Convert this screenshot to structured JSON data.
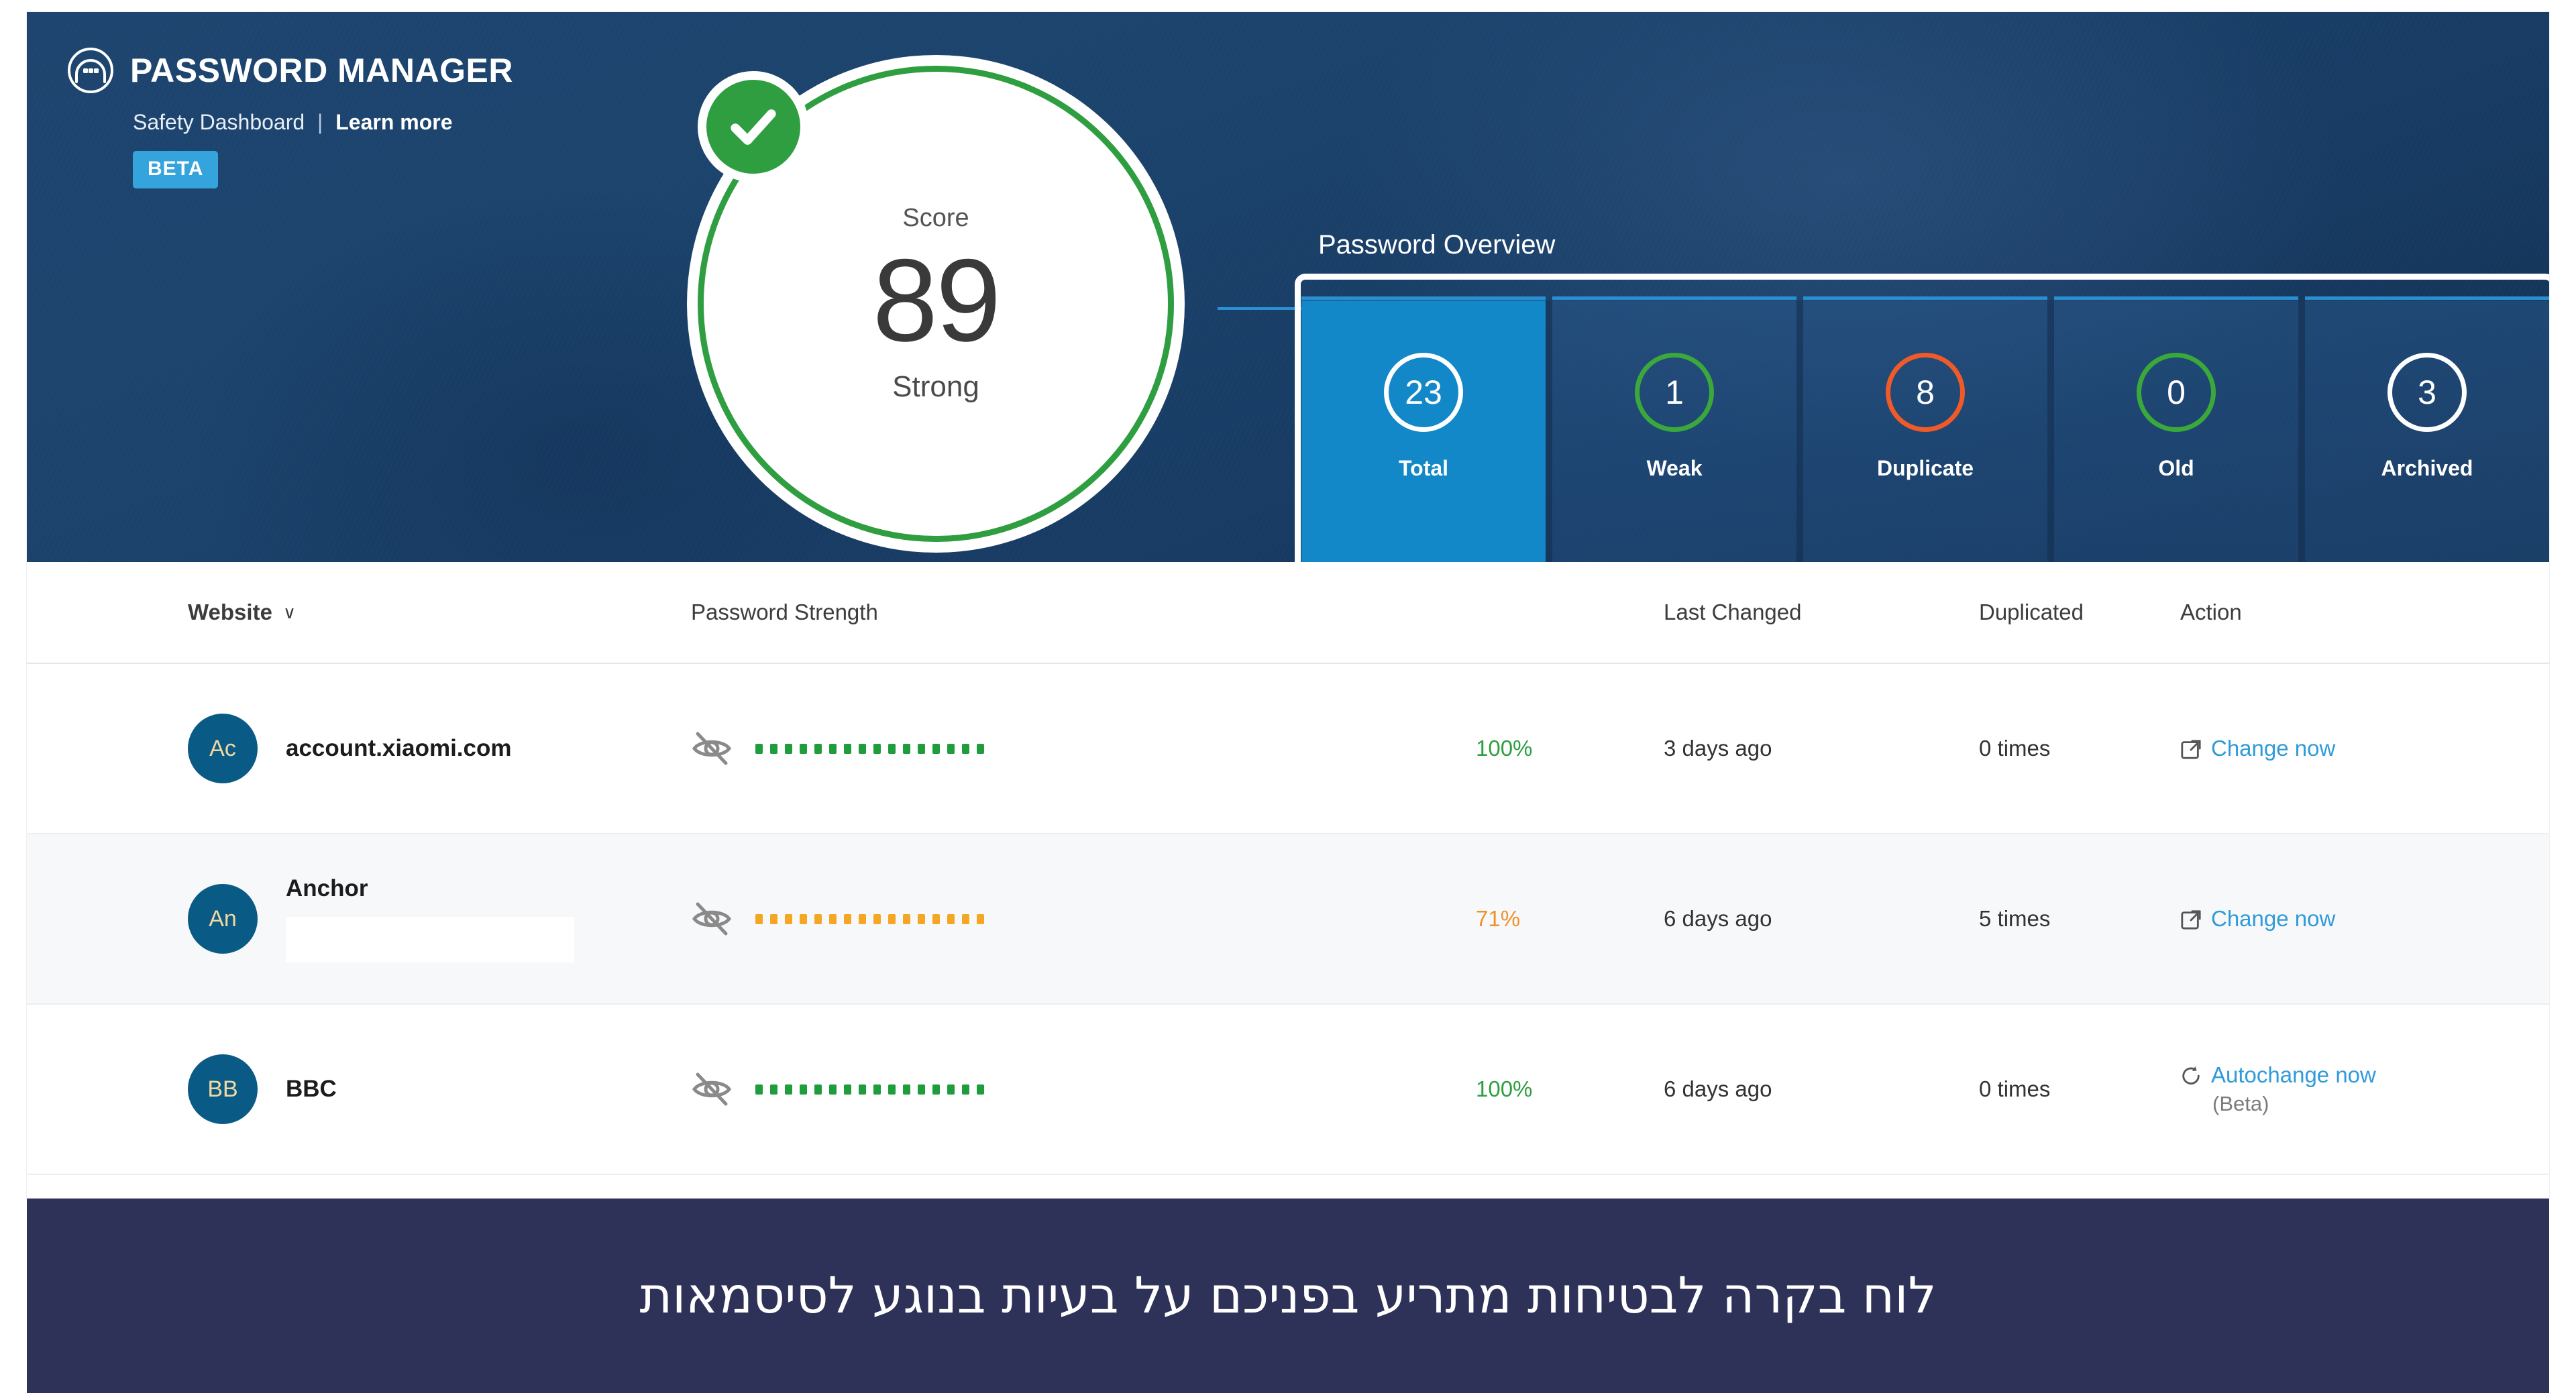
{
  "brand": {
    "logo_icon": "password-manager-logo-icon",
    "title": "PASSWORD MANAGER",
    "subtitle": "Safety Dashboard",
    "separator": "|",
    "learn_more": "Learn more",
    "badge": "BETA"
  },
  "score": {
    "label": "Score",
    "value": "89",
    "state": "Strong",
    "check_icon": "checkmark-icon",
    "ring_color": "#2f9e41",
    "check_color": "#2f9e41"
  },
  "overview": {
    "title": "Password Overview",
    "cards": [
      {
        "value": "23",
        "label": "Total",
        "ring_color": "#ffffff",
        "active": true
      },
      {
        "value": "1",
        "label": "Weak",
        "ring_color": "#3aa83a",
        "active": false
      },
      {
        "value": "8",
        "label": "Duplicate",
        "ring_color": "#f05a28",
        "active": false
      },
      {
        "value": "0",
        "label": "Old",
        "ring_color": "#3aa83a",
        "active": false
      },
      {
        "value": "3",
        "label": "Archived",
        "ring_color": "#ffffff",
        "active": false
      }
    ]
  },
  "table": {
    "headers": {
      "website": "Website",
      "website_caret": "∨",
      "strength": "Password Strength",
      "last_changed": "Last Changed",
      "duplicated": "Duplicated",
      "action": "Action"
    },
    "rows": [
      {
        "avatar": "Ac",
        "site": "account.xiaomi.com",
        "redacted": false,
        "eye_icon": "eye-off-icon",
        "dots_color": "green",
        "dots_count": 16,
        "percent": "100%",
        "percent_tone": "green",
        "last_changed": "3 days ago",
        "duplicated": "0 times",
        "action_icon": "external-link-icon",
        "action_label": "Change now",
        "action_sub": ""
      },
      {
        "avatar": "An",
        "site": "Anchor",
        "redacted": true,
        "eye_icon": "eye-off-icon",
        "dots_color": "orange",
        "dots_count": 16,
        "percent": "71%",
        "percent_tone": "orange",
        "last_changed": "6 days ago",
        "duplicated": "5 times",
        "action_icon": "external-link-icon",
        "action_label": "Change now",
        "action_sub": ""
      },
      {
        "avatar": "BB",
        "site": "BBC",
        "redacted": false,
        "eye_icon": "eye-off-icon",
        "dots_color": "green",
        "dots_count": 16,
        "percent": "100%",
        "percent_tone": "green",
        "last_changed": "6 days ago",
        "duplicated": "0 times",
        "action_icon": "refresh-icon",
        "action_label": "Autochange now",
        "action_sub": "(Beta)"
      }
    ]
  },
  "caption": {
    "text": "לוח בקרה לבטיחות מתריע בפניכם על בעיות בנוגע לסיסמאות"
  }
}
